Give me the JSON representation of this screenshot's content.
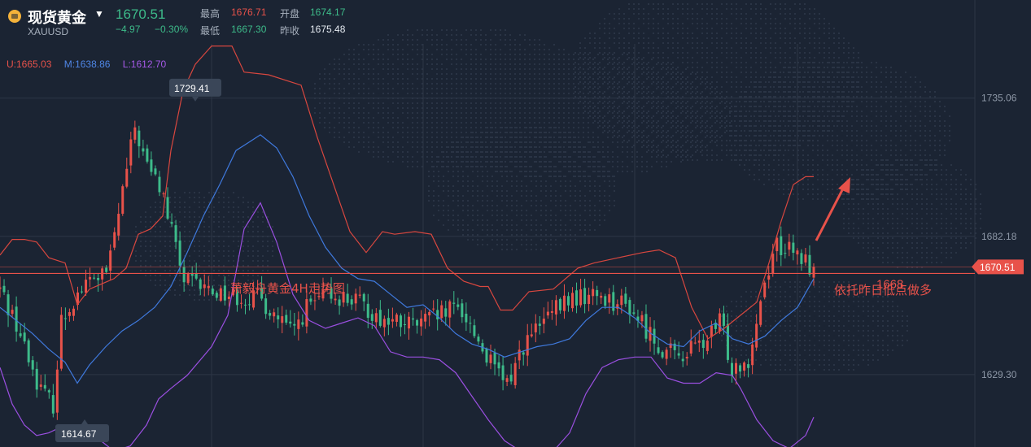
{
  "header": {
    "name": "现货黄金",
    "code": "XAUUSD",
    "last": "1670.51",
    "change": "−4.97",
    "change_pct": "−0.30%",
    "high_label": "最高",
    "high": "1676.71",
    "low_label": "最低",
    "low": "1667.30",
    "open_label": "开盘",
    "open": "1674.17",
    "prev_label": "昨收",
    "prev": "1675.48"
  },
  "bands_legend": {
    "upper": "U:1665.03",
    "middle": "M:1638.86",
    "lower": "L:1612.70"
  },
  "colors": {
    "up": "#e8524a",
    "down": "#3dbb8a",
    "upper_band": "#d8473f",
    "middle_band": "#3f79dd",
    "lower_band": "#9a4fe0",
    "background": "#1b2433"
  },
  "chart_data": {
    "type": "candlestick",
    "title": "萧毅舟黄金4H走势图",
    "annotations": {
      "level_label": "1668",
      "level_value": 1668,
      "note": "依托昨日低点做多",
      "high_marker": "1729.41",
      "low_marker": "1614.67",
      "current_price": "1670.51"
    },
    "y_ticks": [
      "1735.06",
      "1682.18",
      "1629.30"
    ],
    "y_tick_values": [
      1735.06,
      1682.18,
      1629.3
    ],
    "ylim": [
      1601.6,
      1755.8
    ],
    "n_candles": 200,
    "anchors": [
      [
        0,
        1662
      ],
      [
        10,
        1650
      ],
      [
        20,
        1633
      ],
      [
        28,
        1622
      ],
      [
        35,
        1618
      ],
      [
        40,
        1650
      ],
      [
        50,
        1660
      ],
      [
        60,
        1666
      ],
      [
        70,
        1668
      ],
      [
        80,
        1700
      ],
      [
        88,
        1724
      ],
      [
        95,
        1710
      ],
      [
        105,
        1700
      ],
      [
        120,
        1665
      ],
      [
        135,
        1662
      ],
      [
        150,
        1660
      ],
      [
        170,
        1658
      ],
      [
        190,
        1645
      ],
      [
        200,
        1655
      ],
      [
        215,
        1660
      ],
      [
        230,
        1658
      ],
      [
        250,
        1650
      ],
      [
        270,
        1648
      ],
      [
        300,
        1655
      ],
      [
        320,
        1633
      ],
      [
        330,
        1625
      ],
      [
        340,
        1640
      ],
      [
        355,
        1650
      ],
      [
        370,
        1658
      ],
      [
        390,
        1660
      ],
      [
        410,
        1655
      ],
      [
        430,
        1640
      ],
      [
        440,
        1636
      ],
      [
        460,
        1642
      ],
      [
        470,
        1650
      ],
      [
        476,
        1632
      ],
      [
        488,
        1636
      ],
      [
        496,
        1660
      ],
      [
        505,
        1680
      ],
      [
        520,
        1674
      ],
      [
        530,
        1670.51
      ]
    ],
    "upper_band_pts": [
      [
        0,
        1675
      ],
      [
        15,
        1681
      ],
      [
        30,
        1681
      ],
      [
        45,
        1680
      ],
      [
        60,
        1674
      ],
      [
        80,
        1672
      ],
      [
        95,
        1656
      ],
      [
        110,
        1662
      ],
      [
        125,
        1664
      ],
      [
        140,
        1666
      ],
      [
        155,
        1670
      ],
      [
        170,
        1683
      ],
      [
        185,
        1685
      ],
      [
        200,
        1690
      ],
      [
        210,
        1715
      ],
      [
        225,
        1738
      ],
      [
        240,
        1748
      ],
      [
        260,
        1755
      ],
      [
        285,
        1755
      ],
      [
        300,
        1745
      ],
      [
        330,
        1744
      ],
      [
        370,
        1740
      ],
      [
        390,
        1720
      ],
      [
        410,
        1702
      ],
      [
        430,
        1684
      ],
      [
        450,
        1676
      ],
      [
        470,
        1684
      ],
      [
        485,
        1683
      ],
      [
        510,
        1684
      ],
      [
        530,
        1683
      ],
      [
        550,
        1670
      ],
      [
        570,
        1665
      ],
      [
        590,
        1663
      ],
      [
        600,
        1663
      ],
      [
        615,
        1654
      ],
      [
        630,
        1654
      ],
      [
        650,
        1661
      ],
      [
        680,
        1662
      ],
      [
        710,
        1670
      ],
      [
        730,
        1672
      ],
      [
        760,
        1674
      ],
      [
        790,
        1676
      ],
      [
        810,
        1677
      ],
      [
        830,
        1674
      ],
      [
        850,
        1655
      ],
      [
        870,
        1643
      ],
      [
        890,
        1647
      ],
      [
        910,
        1652
      ],
      [
        930,
        1657
      ],
      [
        945,
        1672
      ],
      [
        960,
        1688
      ],
      [
        975,
        1702
      ],
      [
        990,
        1705
      ],
      [
        1000,
        1705
      ]
    ],
    "middle_band_pts": [
      [
        0,
        1655
      ],
      [
        20,
        1650
      ],
      [
        40,
        1645
      ],
      [
        60,
        1639
      ],
      [
        80,
        1634
      ],
      [
        95,
        1626
      ],
      [
        110,
        1633
      ],
      [
        130,
        1640
      ],
      [
        150,
        1646
      ],
      [
        170,
        1650
      ],
      [
        190,
        1655
      ],
      [
        210,
        1663
      ],
      [
        230,
        1676
      ],
      [
        250,
        1690
      ],
      [
        270,
        1702
      ],
      [
        290,
        1715
      ],
      [
        305,
        1718
      ],
      [
        320,
        1721
      ],
      [
        340,
        1716
      ],
      [
        360,
        1705
      ],
      [
        380,
        1690
      ],
      [
        400,
        1678
      ],
      [
        420,
        1670
      ],
      [
        440,
        1666
      ],
      [
        460,
        1665
      ],
      [
        480,
        1660
      ],
      [
        500,
        1655
      ],
      [
        520,
        1656
      ],
      [
        540,
        1651
      ],
      [
        560,
        1645
      ],
      [
        580,
        1641
      ],
      [
        600,
        1639
      ],
      [
        620,
        1636
      ],
      [
        640,
        1638
      ],
      [
        660,
        1640
      ],
      [
        680,
        1641
      ],
      [
        700,
        1643
      ],
      [
        720,
        1650
      ],
      [
        740,
        1655
      ],
      [
        760,
        1655
      ],
      [
        780,
        1651
      ],
      [
        800,
        1645
      ],
      [
        820,
        1641
      ],
      [
        840,
        1640
      ],
      [
        860,
        1646
      ],
      [
        880,
        1649
      ],
      [
        900,
        1643
      ],
      [
        920,
        1641
      ],
      [
        940,
        1644
      ],
      [
        960,
        1650
      ],
      [
        980,
        1655
      ],
      [
        1000,
        1666
      ]
    ],
    "lower_band_pts": [
      [
        0,
        1632
      ],
      [
        15,
        1618
      ],
      [
        30,
        1610
      ],
      [
        45,
        1606
      ],
      [
        60,
        1607
      ],
      [
        80,
        1610
      ],
      [
        100,
        1604
      ],
      [
        120,
        1605
      ],
      [
        140,
        1600
      ],
      [
        160,
        1602
      ],
      [
        180,
        1610
      ],
      [
        195,
        1620
      ],
      [
        210,
        1624
      ],
      [
        230,
        1629
      ],
      [
        260,
        1640
      ],
      [
        280,
        1652
      ],
      [
        300,
        1685
      ],
      [
        320,
        1695
      ],
      [
        340,
        1680
      ],
      [
        360,
        1660
      ],
      [
        380,
        1650
      ],
      [
        400,
        1647
      ],
      [
        420,
        1649
      ],
      [
        440,
        1651
      ],
      [
        460,
        1648
      ],
      [
        480,
        1638
      ],
      [
        500,
        1636
      ],
      [
        520,
        1636
      ],
      [
        540,
        1635
      ],
      [
        560,
        1630
      ],
      [
        580,
        1621
      ],
      [
        600,
        1612
      ],
      [
        620,
        1604
      ],
      [
        640,
        1600
      ],
      [
        660,
        1598
      ],
      [
        680,
        1600
      ],
      [
        700,
        1607
      ],
      [
        720,
        1622
      ],
      [
        740,
        1632
      ],
      [
        760,
        1635
      ],
      [
        780,
        1636
      ],
      [
        800,
        1636
      ],
      [
        820,
        1628
      ],
      [
        840,
        1626
      ],
      [
        860,
        1626
      ],
      [
        880,
        1630
      ],
      [
        900,
        1629
      ],
      [
        910,
        1624
      ],
      [
        930,
        1612
      ],
      [
        950,
        1604
      ],
      [
        970,
        1601
      ],
      [
        990,
        1606
      ],
      [
        1000,
        1613
      ]
    ]
  }
}
